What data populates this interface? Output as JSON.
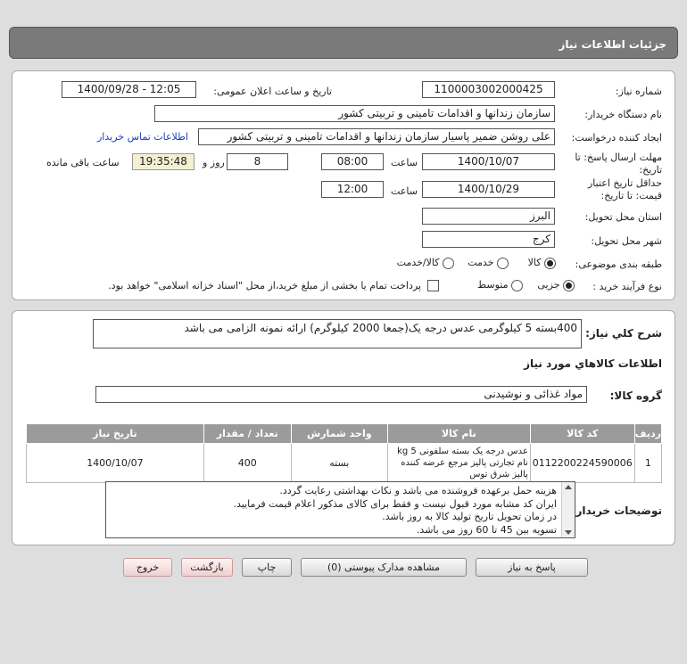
{
  "header": {
    "title": "جزئیات اطلاعات نیاز"
  },
  "labels": {
    "need_number": "شماره نیاز:",
    "announce_datetime": "تاریخ و ساعت اعلان عمومی:",
    "buyer_org": "نام دستگاه خریدار:",
    "requester": "ایجاد کننده درخواست:",
    "send_deadline": "مهلت ارسال پاسخ: تا تاریخ:",
    "time": "ساعت",
    "days_and": "روز و",
    "remaining": "ساعت باقی مانده",
    "price_validity": "حداقل تاریخ اعتبار قیمت: تا تاریخ:",
    "province": "استان محل تحویل:",
    "city": "شهر محل تحویل:",
    "category": "طبقه بندی موضوعی:",
    "process_type": "نوع فرآیند خرید :",
    "general_desc": "شرح کلي نياز:",
    "goods_info": "اطلاعات کالاهاي مورد نياز",
    "goods_group": "گروه کالا:",
    "buyer_notes": "توضیحات خریدار:"
  },
  "fields": {
    "need_number": "1100003002000425",
    "announce_datetime": "1400/09/28 - 12:05",
    "buyer_org": "سازمان زندانها و اقدامات تامینی و تربیتی کشور",
    "requester": "علی روشن ضمیر پاسیار سازمان زندانها و اقدامات تامینی و تربیتی کشور",
    "contact_link": "اطلاعات تماس خریدار",
    "deadline_date": "1400/10/07",
    "deadline_time": "08:00",
    "days": "8",
    "remaining_time": "19:35:48",
    "validity_date": "1400/10/29",
    "validity_time": "12:00",
    "province": "البرز",
    "city": "کرج",
    "general_desc": "400بسته 5 کیلوگرمی عدس درجه یک(جمعا 2000 کیلوگرم) ارائه نمونه الزامی می باشد",
    "goods_group": "مواد غذائی و نوشیدنی"
  },
  "category_options": [
    {
      "label": "کالا",
      "selected": true
    },
    {
      "label": "خدمت",
      "selected": false
    },
    {
      "label": "کالا/خدمت",
      "selected": false
    }
  ],
  "process_options": [
    {
      "label": "جزیی",
      "selected": true
    },
    {
      "label": "متوسط",
      "selected": false
    }
  ],
  "payment_note": "پرداخت تمام یا بخشی از مبلغ خرید،از محل \"اسناد خزانه اسلامی\" خواهد بود.",
  "table": {
    "headers": [
      "ردیف",
      "کد کالا",
      "نام کالا",
      "واحد شمارش",
      "تعداد / مقدار",
      "تاریخ نیاز"
    ],
    "rows": [
      {
        "row": "1",
        "code": "0112200224590006",
        "name": "عدس درجه یک بسته سلفونی 5 kg نام تجارتی پالیز مرجع عرضه کننده پالیز شرق توس",
        "unit": "بسته",
        "qty": "400",
        "date": "1400/10/07"
      }
    ]
  },
  "buyer_notes": [
    "هزینه حمل برعهده فروشنده می باشد و نکات بهداشتی رعایت گردد.",
    "ایران کد مشابه مورد قبول نیست و فقط برای کالای مذکور اعلام قیمت فرمایید.",
    "در زمان تحویل تاریخ تولید کالا به روز باشد.",
    "تسویه بین 45 تا 60 روز می باشد."
  ],
  "buttons": {
    "reply": "پاسخ به نیاز",
    "view_docs": "مشاهده مدارک پیوستی (0)",
    "print": "چاپ",
    "back": "بازگشت",
    "exit": "خروج"
  },
  "colors": {
    "header_bg": "#7a7a7a",
    "table_header_bg": "#9b9b9b",
    "link": "#1a3fb4",
    "remaining_bg": "#f4f0d2",
    "red_button_bg": "#f0cfcf"
  }
}
